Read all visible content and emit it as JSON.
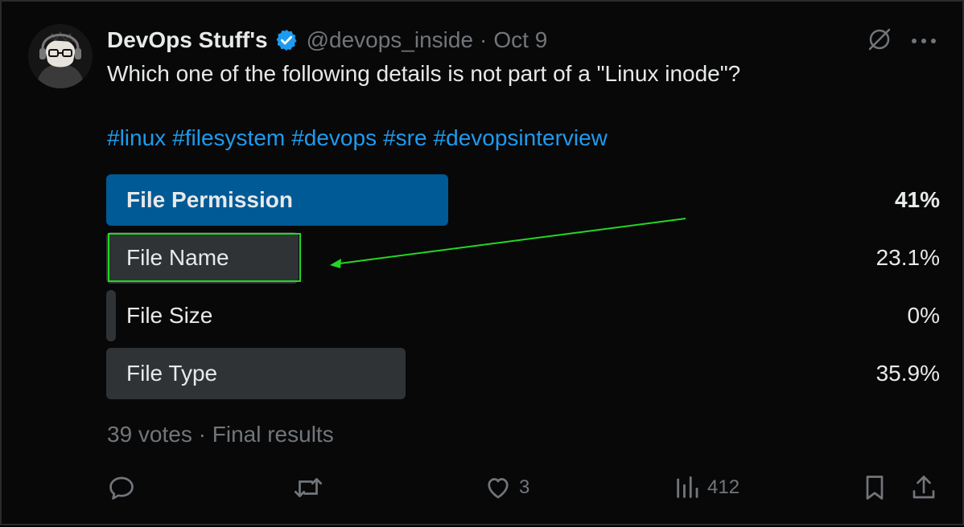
{
  "tweet": {
    "author_name": "DevOps Stuff's",
    "handle": "@devops_inside",
    "separator": "·",
    "date": "Oct 9",
    "question": "Which one of the following details is not part of a \"Linux inode\"?",
    "hashtags": [
      "#linux",
      "#filesystem",
      "#devops",
      "#sre",
      "#devopsinterview"
    ]
  },
  "poll": {
    "options": [
      {
        "label": "File Permission",
        "percent_text": "41%",
        "share": 0.41,
        "winner": true
      },
      {
        "label": "File Name",
        "percent_text": "23.1%",
        "share": 0.231,
        "winner": false
      },
      {
        "label": "File Size",
        "percent_text": "0%",
        "share": 0.0,
        "winner": false
      },
      {
        "label": "File Type",
        "percent_text": "35.9%",
        "share": 0.359,
        "winner": false
      }
    ],
    "votes": "39 votes",
    "status": "Final results",
    "meta_separator": " · "
  },
  "actions": {
    "reply_icon": "reply-icon",
    "retweet_icon": "retweet-icon",
    "like_icon": "heart-icon",
    "like_count": "3",
    "views_icon": "views-icon",
    "views_count": "412",
    "bookmark_icon": "bookmark-icon",
    "share_icon": "share-icon"
  },
  "colors": {
    "accent": "#1d9bf0",
    "winner_bar": "#005a95",
    "bar": "#2f3336",
    "annotation": "#22d822",
    "muted": "#71767b"
  }
}
